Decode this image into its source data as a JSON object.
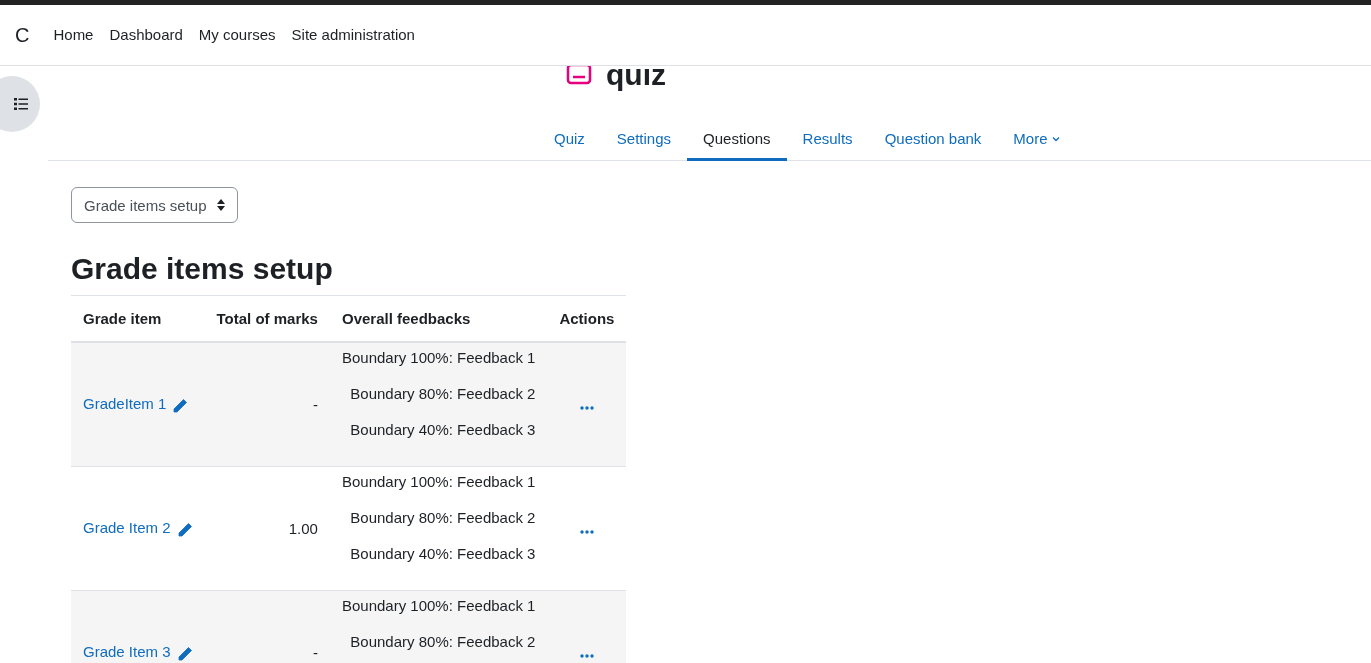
{
  "navbar": {
    "logo": "C",
    "links": [
      "Home",
      "Dashboard",
      "My courses",
      "Site administration"
    ]
  },
  "page_title": "quiz",
  "tabs": [
    {
      "label": "Quiz",
      "selected": false
    },
    {
      "label": "Settings",
      "selected": false
    },
    {
      "label": "Questions",
      "selected": true
    },
    {
      "label": "Results",
      "selected": false
    },
    {
      "label": "Question bank",
      "selected": false
    },
    {
      "label": "More",
      "selected": false,
      "kind": "dropdown"
    }
  ],
  "view_select": {
    "value": "Grade items setup"
  },
  "heading": "Grade items setup",
  "table": {
    "columns": [
      "Grade item",
      "Total of marks",
      "Overall feedbacks",
      "Actions"
    ],
    "rows": [
      {
        "grade_item": "GradeItem 1",
        "total_of_marks": "-",
        "overall_feedbacks": [
          "Boundary 100%: Feedback 1",
          "Boundary 80%: Feedback 2",
          "Boundary 40%: Feedback 3"
        ]
      },
      {
        "grade_item": "Grade Item 2",
        "total_of_marks": "1.00",
        "overall_feedbacks": [
          "Boundary 100%: Feedback 1",
          "Boundary 80%: Feedback 2",
          "Boundary 40%: Feedback 3"
        ]
      },
      {
        "grade_item": "Grade Item 3",
        "total_of_marks": "-",
        "overall_feedbacks": [
          "Boundary 100%: Feedback 1",
          "Boundary 80%: Feedback 2"
        ]
      }
    ]
  }
}
